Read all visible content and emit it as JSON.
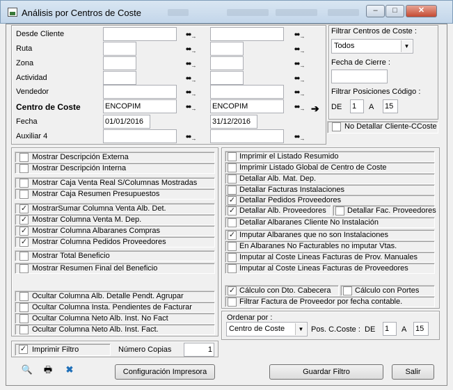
{
  "window": {
    "title": "Análisis por Centros de Coste",
    "minimize": "–",
    "maximize": "□",
    "close": "✕"
  },
  "filters": {
    "labels": [
      "Desde Cliente",
      "Ruta",
      "Zona",
      "Actividad",
      "Vendedor",
      "Centro de Coste",
      "Fecha",
      "Auxiliar 4"
    ],
    "from_values": [
      "",
      "",
      "",
      "",
      "",
      "ENCOPIM",
      "01/01/2016",
      ""
    ],
    "to_values": [
      "",
      "",
      "",
      "",
      "",
      "ENCOPIM",
      "31/12/2016",
      ""
    ]
  },
  "right_panel": {
    "filtrar_centros_label": "Filtrar Centros de Coste :",
    "filtrar_centros_value": "Todos",
    "fecha_cierre_label": "Fecha de Cierre :",
    "fecha_cierre_value": "",
    "filtrar_posiciones_label": "Filtrar Posiciones Código :",
    "de_label": "DE",
    "de_value": "1",
    "a_label": "A",
    "a_value": "15",
    "no_detallar_label": "No Detallar Cliente-CCoste",
    "no_detallar_checked": false
  },
  "left_options": [
    {
      "label": "Mostrar Descripción Externa",
      "checked": false
    },
    {
      "label": "Mostrar Descripción Interna",
      "checked": false
    },
    {
      "label": "Mostrar Caja Venta Real S/Columnas Mostradas",
      "checked": false
    },
    {
      "label": "Mostrar Caja Resumen Presupuestos",
      "checked": false
    },
    {
      "label": "MostrarSumar Columna Venta Alb. Det.",
      "checked": true
    },
    {
      "label": "Mostrar Columna Venta M. Dep.",
      "checked": true
    },
    {
      "label": "Mostrar Columna Albaranes Compras",
      "checked": true
    },
    {
      "label": "Mostrar Columna Pedidos Proveedores",
      "checked": true
    },
    {
      "label": "Mostrar Total Beneficio",
      "checked": false
    },
    {
      "label": "Mostrar Resumen Final del Beneficio",
      "checked": false
    },
    {
      "label": "Ocultar Columna Alb. Detalle Pendt. Agrupar",
      "checked": false
    },
    {
      "label": "Ocultar Columna Insta. Pendientes de Facturar",
      "checked": false
    },
    {
      "label": "Ocultar Columna Neto Alb. Inst. No Fact",
      "checked": false
    },
    {
      "label": "Ocultar Columna Neto Alb. Inst. Fact.",
      "checked": false
    }
  ],
  "right_options": [
    {
      "label": "Imprimir el Listado Resumido",
      "checked": false
    },
    {
      "label": "Imprimir Listado Global de Centro de Coste",
      "checked": false
    },
    {
      "label": "Detallar Alb. Mat. Dep.",
      "checked": false
    },
    {
      "label": "Detallar Facturas Instalaciones",
      "checked": false
    },
    {
      "label": "Detallar Pedidos Proveedores",
      "checked": true
    },
    {
      "label": "Detallar Alb. Proveedores",
      "checked": true
    },
    {
      "label": "Detallar Fac. Proveedores",
      "checked": false
    },
    {
      "label": "Detallar Albaranes Cliente No Instalación",
      "checked": false
    },
    {
      "label": "Imputar Albaranes que no son Instalaciones",
      "checked": true
    },
    {
      "label": "En Albaranes No Facturables no imputar Vtas.",
      "checked": false
    },
    {
      "label": "Imputar al Coste Lineas Facturas de Prov. Manuales",
      "checked": false
    },
    {
      "label": "Imputar al Coste Lineas Facturas de Proveedores",
      "checked": false
    },
    {
      "label": "Cálculo con Dto. Cabecera",
      "checked": true
    },
    {
      "label": "Cálculo con Portes",
      "checked": false
    },
    {
      "label": "Filtrar Factura de Proveedor por fecha contable.",
      "checked": false
    }
  ],
  "ordenar": {
    "label": "Ordenar por :",
    "value": "Centro de Coste",
    "pos_label": "Pos. C.Coste :",
    "de_label": "DE",
    "de_value": "1",
    "a_label": "A",
    "a_value": "15"
  },
  "print": {
    "imprimir_filtro_label": "Imprimir Filtro",
    "imprimir_filtro_checked": true,
    "copias_label": "Número Copias",
    "copias_value": "1"
  },
  "buttons": {
    "config": "Configuración Impresora",
    "guardar": "Guardar Filtro",
    "salir": "Salir"
  },
  "check_mark": "✓"
}
